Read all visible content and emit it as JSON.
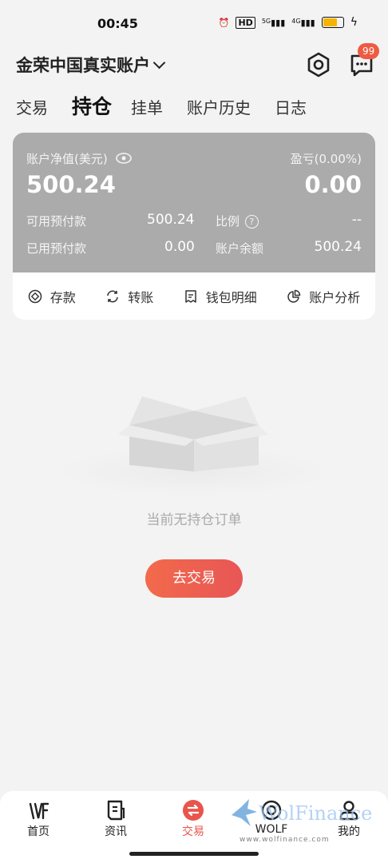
{
  "status_bar": {
    "time": "00:45",
    "net1": "HD",
    "net2": "5G",
    "net3": "4G"
  },
  "header": {
    "account_title": "金荣中国真实账户",
    "badge": "99"
  },
  "tabs": [
    {
      "label": "交易"
    },
    {
      "label": "持仓"
    },
    {
      "label": "挂单"
    },
    {
      "label": "账户历史"
    },
    {
      "label": "日志"
    }
  ],
  "account": {
    "equity_label": "账户净值(美元)",
    "equity_value": "500.24",
    "pl_label": "盈亏(0.00%)",
    "pl_value": "0.00",
    "available_label": "可用预付款",
    "available_value": "500.24",
    "ratio_label": "比例",
    "ratio_value": "--",
    "used_label": "已用预付款",
    "used_value": "0.00",
    "balance_label": "账户余额",
    "balance_value": "500.24",
    "accent": "#ababab"
  },
  "actions": [
    {
      "label": "存款"
    },
    {
      "label": "转账"
    },
    {
      "label": "钱包明细"
    },
    {
      "label": "账户分析"
    }
  ],
  "empty_state": {
    "message": "当前无持仓订单",
    "button": "去交易"
  },
  "bottom_nav": [
    {
      "label": "首页"
    },
    {
      "label": "资讯"
    },
    {
      "label": "交易"
    },
    {
      "label": "WOLF"
    },
    {
      "label": "我的"
    }
  ],
  "watermark": {
    "brand": "WolFinance",
    "url": "www.wolfinance.com"
  },
  "colors": {
    "primary": "#e8554c",
    "background": "#f3f3f3"
  }
}
